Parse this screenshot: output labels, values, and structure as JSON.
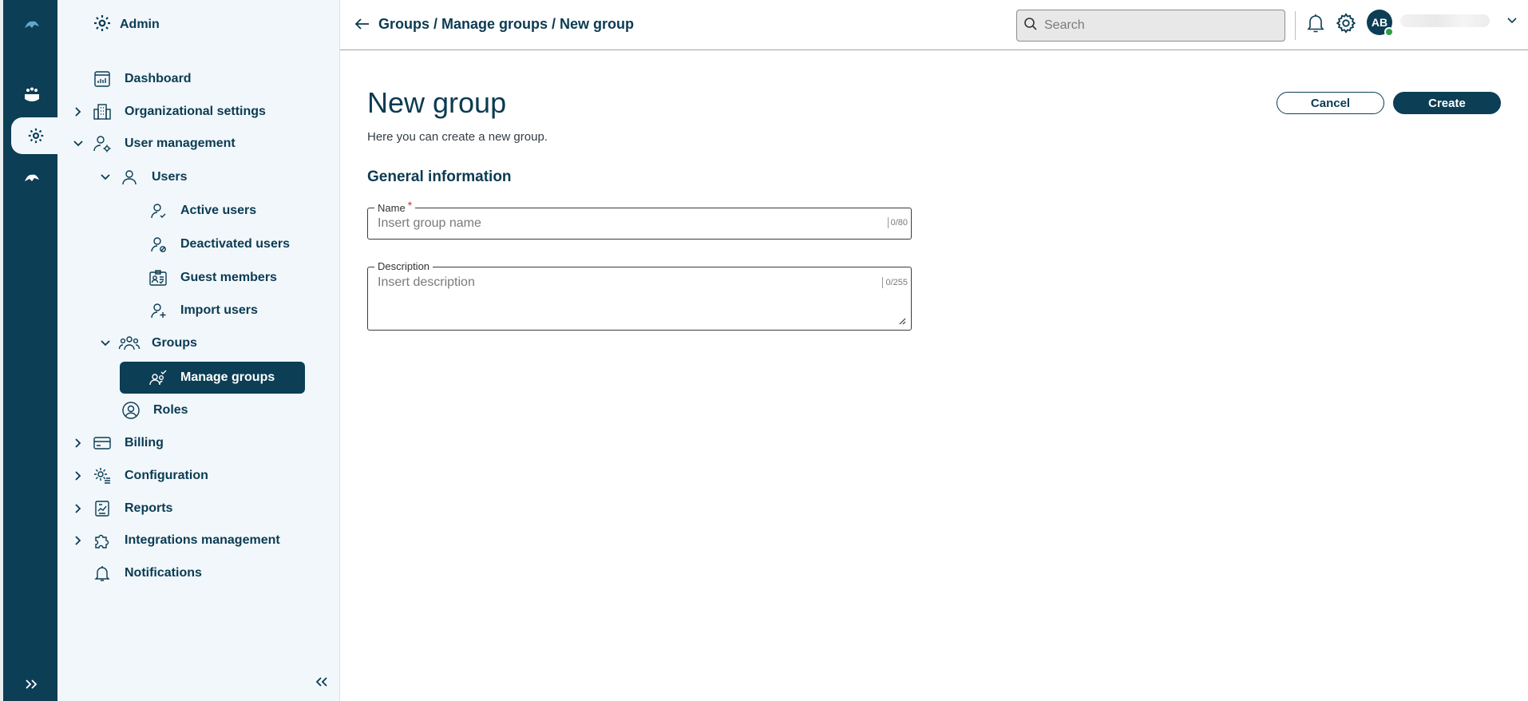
{
  "rail": {
    "items": [
      {
        "name": "logo"
      },
      {
        "name": "apps"
      },
      {
        "name": "admin"
      },
      {
        "name": "cloud"
      }
    ]
  },
  "sidebar": {
    "header": "Admin",
    "items": {
      "dashboard": "Dashboard",
      "org_settings": "Organizational settings",
      "user_management": "User management",
      "users": "Users",
      "active_users": "Active users",
      "deactivated_users": "Deactivated users",
      "guest_members": "Guest members",
      "import_users": "Import users",
      "groups": "Groups",
      "manage_groups": "Manage groups",
      "roles": "Roles",
      "billing": "Billing",
      "configuration": "Configuration",
      "reports": "Reports",
      "integrations": "Integrations management",
      "notifications": "Notifications"
    }
  },
  "topbar": {
    "breadcrumb": "Groups / Manage groups / New group",
    "search_placeholder": "Search",
    "avatar_initials": "AB"
  },
  "main": {
    "title": "New group",
    "subtitle": "Here you can create a new group.",
    "cancel_label": "Cancel",
    "create_label": "Create",
    "section_title": "General information",
    "name_field": {
      "label": "Name",
      "required_mark": "*",
      "placeholder": "Insert group name",
      "counter": "0/80"
    },
    "description_field": {
      "label": "Description",
      "placeholder": "Insert description",
      "counter": "0/255"
    }
  },
  "colors": {
    "primary": "#0c3e55",
    "sidebar_bg": "#f1f7fb",
    "required": "#d32f2f",
    "presence": "#2f9e44"
  }
}
